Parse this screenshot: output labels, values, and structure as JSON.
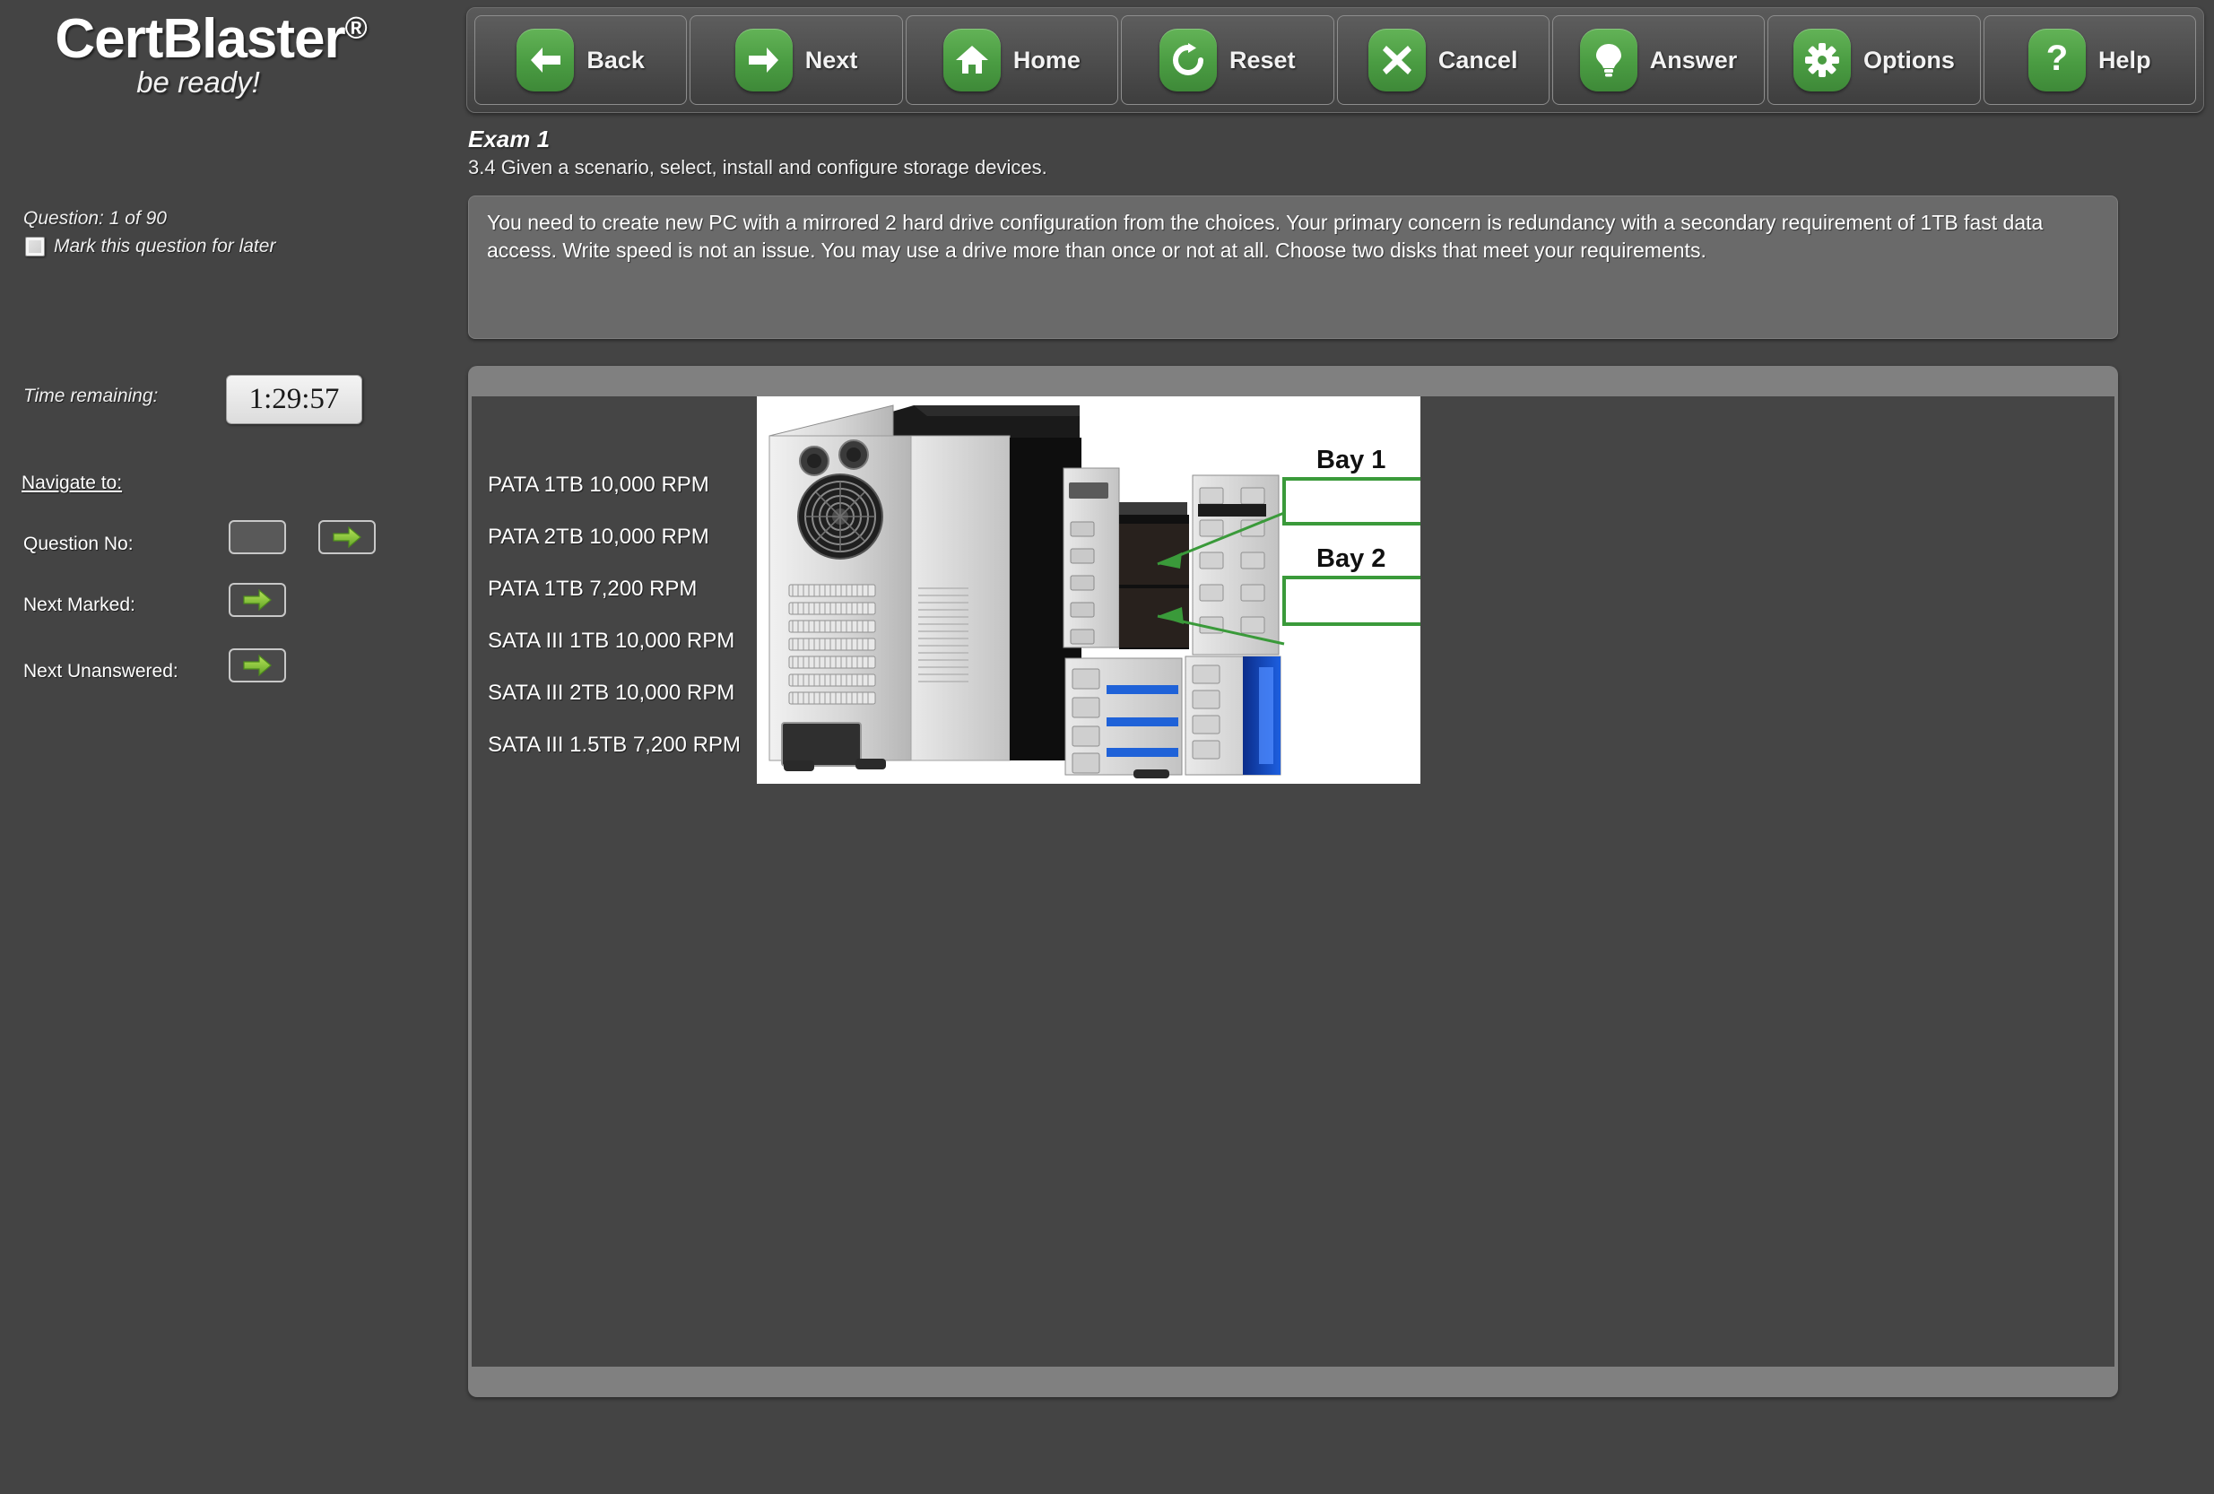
{
  "brand": {
    "name": "CertBlaster",
    "registered": "®",
    "tagline": "be ready!"
  },
  "toolbar": {
    "buttons": [
      {
        "label": "Back",
        "icon": "arrow-left-icon"
      },
      {
        "label": "Next",
        "icon": "arrow-right-icon"
      },
      {
        "label": "Home",
        "icon": "home-icon"
      },
      {
        "label": "Reset",
        "icon": "refresh-icon"
      },
      {
        "label": "Cancel",
        "icon": "close-x-icon"
      },
      {
        "label": "Answer",
        "icon": "lightbulb-icon"
      },
      {
        "label": "Options",
        "icon": "gear-icon"
      },
      {
        "label": "Help",
        "icon": "question-mark-icon"
      }
    ]
  },
  "sidebar": {
    "question_counter": "Question: 1 of 90",
    "mark_label": "Mark this question for later",
    "mark_checked": false,
    "time_label": "Time remaining:",
    "time_value": "1:29:57",
    "navigate_title": "Navigate to:",
    "nav_rows": [
      {
        "label": "Question No:",
        "value": ""
      },
      {
        "label": "Next Marked:",
        "value": ""
      },
      {
        "label": "Next Unanswered:",
        "value": ""
      }
    ]
  },
  "exam": {
    "title": "Exam 1",
    "objective": "3.4 Given a scenario, select, install and configure storage devices.",
    "question_text": "You need to create new PC with a mirrored 2 hard drive configuration from the choices. Your primary concern is redundancy with a secondary requirement of 1TB fast data access. Write speed is not an issue. You may use a drive more than once or not at all. Choose two disks that meet your requirements."
  },
  "choices": [
    "PATA 1TB 10,000 RPM",
    "PATA 2TB 10,000 RPM",
    "PATA 1TB 7,200 RPM",
    "SATA III 1TB 10,000 RPM",
    "SATA III 2TB 10,000 RPM",
    "SATA III 1.5TB 7,200 RPM"
  ],
  "diagram": {
    "bays": [
      {
        "label": "Bay 1",
        "value": ""
      },
      {
        "label": "Bay 2",
        "value": ""
      }
    ]
  },
  "colors": {
    "page_background": "#444444",
    "panel_light": "#6a6a6a",
    "content_frame": "#808080",
    "content_background": "#454545",
    "accent_green": "#4a9c42",
    "arrow_green": "#8dc63f",
    "bay_outline": "#3a9a3a",
    "text_white": "#ffffff"
  }
}
